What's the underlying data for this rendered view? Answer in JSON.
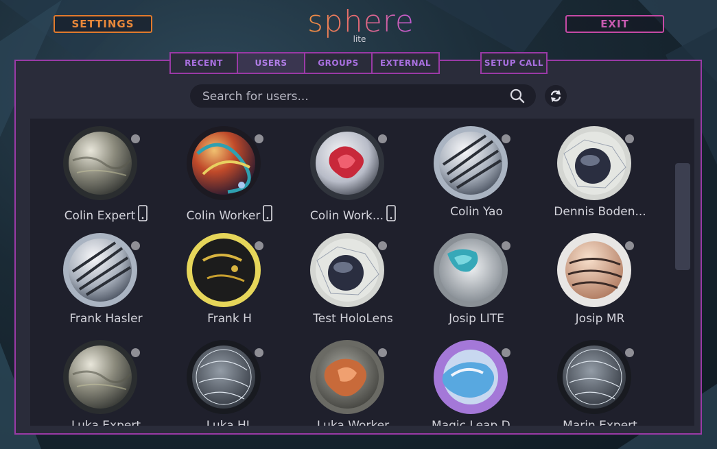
{
  "header": {
    "settings_label": "SETTINGS",
    "exit_label": "EXIT",
    "logo_text": "sphere",
    "logo_sub": "lite"
  },
  "tabs": [
    {
      "label": "RECENT",
      "active": false
    },
    {
      "label": "USERS",
      "active": true
    },
    {
      "label": "GROUPS",
      "active": false
    },
    {
      "label": "EXTERNAL",
      "active": false
    }
  ],
  "setup_call_label": "SETUP CALL",
  "search": {
    "placeholder": "Search for users..."
  },
  "users": [
    {
      "name": "Colin Expert",
      "phone": true,
      "sphere": "marble-gray"
    },
    {
      "name": "Colin Worker",
      "phone": true,
      "sphere": "swirl-red"
    },
    {
      "name": "Colin Work...",
      "phone": true,
      "sphere": "red-smoke"
    },
    {
      "name": "Colin Yao",
      "phone": false,
      "sphere": "ribbon-silver"
    },
    {
      "name": "Dennis Boden...",
      "phone": false,
      "sphere": "wire-globe"
    },
    {
      "name": "Frank Hasler",
      "phone": false,
      "sphere": "ribbon-silver"
    },
    {
      "name": "Frank H",
      "phone": false,
      "sphere": "gold-black"
    },
    {
      "name": "Test HoloLens",
      "phone": false,
      "sphere": "wire-globe"
    },
    {
      "name": "Josip LITE",
      "phone": false,
      "sphere": "teal-crystal"
    },
    {
      "name": "Josip MR",
      "phone": false,
      "sphere": "peach-layers"
    },
    {
      "name": "Luka Expert",
      "phone": false,
      "sphere": "marble-gray"
    },
    {
      "name": "Luka HL",
      "phone": false,
      "sphere": "wire-glass"
    },
    {
      "name": "Luka Worker",
      "phone": false,
      "sphere": "copper-splash"
    },
    {
      "name": "Magic Leap D...",
      "phone": false,
      "sphere": "blue-paint"
    },
    {
      "name": "Marin Expert",
      "phone": false,
      "sphere": "wire-glass"
    }
  ],
  "colors": {
    "accent_border": "#9a3aa6",
    "settings": "#e27a2c",
    "exit": "#c64aa5",
    "status_offline": "#8f8f96"
  }
}
